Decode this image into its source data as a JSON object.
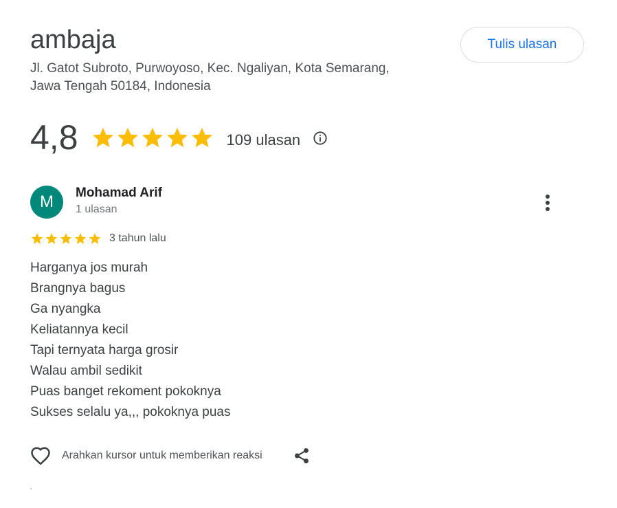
{
  "place": {
    "name": "ambaja",
    "address_line1": "Jl. Gatot Subroto, Purwoyoso, Kec. Ngaliyan, Kota Semarang,",
    "address_line2": "Jawa Tengah 50184, Indonesia"
  },
  "actions": {
    "write_review_label": "Tulis ulasan"
  },
  "summary": {
    "rating": "4,8",
    "rating_stars": 5,
    "review_count_label": "109 ulasan",
    "info_icon": "info-icon"
  },
  "review": {
    "avatar_letter": "M",
    "avatar_color": "#00897b",
    "author": "Mohamad Arif",
    "author_meta": "1 ulasan",
    "stars": 5,
    "time": "3 tahun lalu",
    "lines": [
      "Harganya jos murah",
      "Brangnya bagus",
      "Ga nyangka",
      "Keliatannya kecil",
      "Tapi ternyata harga grosir",
      "Walau ambil sedikit",
      "Puas banget rekoment pokoknya",
      "Sukses selalu ya,,, pokoknya puas"
    ],
    "reaction_hint": "Arahkan kursor untuk memberikan reaksi"
  },
  "colors": {
    "star": "#fbbc04",
    "accent": "#1a73e8",
    "icon": "#3c4043"
  }
}
